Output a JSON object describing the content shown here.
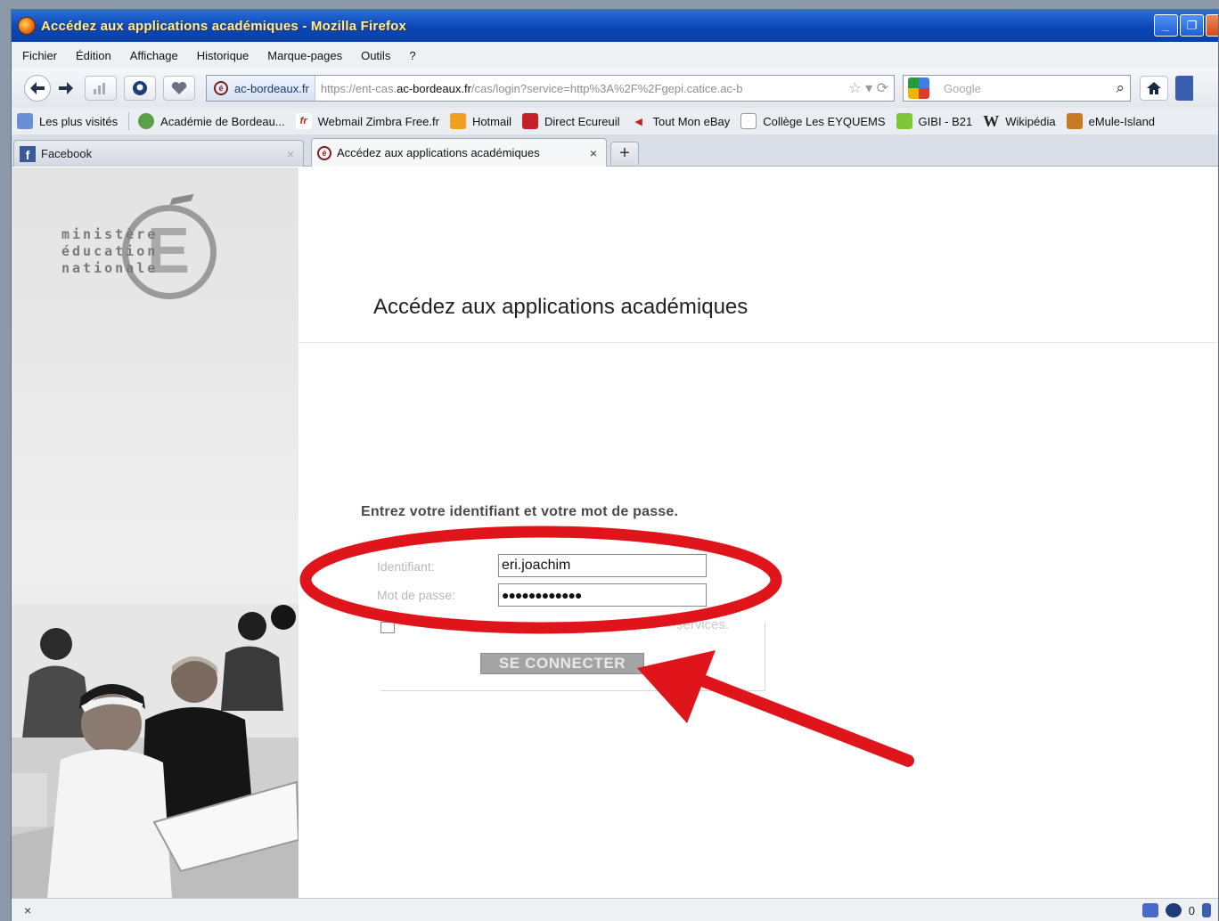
{
  "window": {
    "title": "Accédez aux applications académiques - Mozilla Firefox",
    "controls": [
      "_",
      "❐",
      ""
    ]
  },
  "menubar": {
    "items": [
      "Fichier",
      "Édition",
      "Affichage",
      "Historique",
      "Marque-pages",
      "Outils",
      "?"
    ]
  },
  "navbar": {
    "site_identity": "ac-bordeaux.fr",
    "url_prefix": "https://ent-cas.",
    "url_domain": "ac-bordeaux.fr",
    "url_rest": "/cas/login?service=http%3A%2F%2Fgepi.catice.ac-b",
    "search_placeholder": "Google"
  },
  "bookmarks": {
    "items": [
      {
        "label": "Les plus visités",
        "icon": "most-visited-icon"
      },
      {
        "label": "Académie de Bordeau...",
        "icon": "academie-icon"
      },
      {
        "label": "Webmail Zimbra Free.fr",
        "icon": "free-icon"
      },
      {
        "label": "Hotmail",
        "icon": "hotmail-icon"
      },
      {
        "label": "Direct Ecureuil",
        "icon": "ecureuil-icon"
      },
      {
        "label": "Tout Mon eBay",
        "icon": "ebay-icon"
      },
      {
        "label": "Collège Les EYQUEMS",
        "icon": "page-icon"
      },
      {
        "label": "GIBI - B21",
        "icon": "gibi-icon"
      },
      {
        "label": "Wikipédia",
        "icon": "wikipedia-icon"
      },
      {
        "label": "eMule-Island",
        "icon": "emule-icon"
      }
    ]
  },
  "tabs": [
    {
      "label": "Facebook",
      "active": false
    },
    {
      "label": "Accédez aux applications académiques",
      "active": true
    }
  ],
  "newtab_label": "+",
  "page": {
    "logo_text": [
      "ministère",
      "éducation",
      "nationale"
    ],
    "logo_letter": "E",
    "title": "Accédez aux applications académiques",
    "prompt": "Entrez votre identifiant et votre mot de passe.",
    "username_label": "Identifiant:",
    "username_value": "eri.joachim",
    "password_label": "Mot de passe:",
    "password_value": "●●●●●●●●●●●●",
    "remember_text": "services.",
    "submit_label": "SE CONNECTER"
  },
  "statusbar": {
    "left": "×",
    "count": "0"
  },
  "colors": {
    "annotation_red": "#e0141b",
    "titlebar_blue": "#0a46b8"
  }
}
